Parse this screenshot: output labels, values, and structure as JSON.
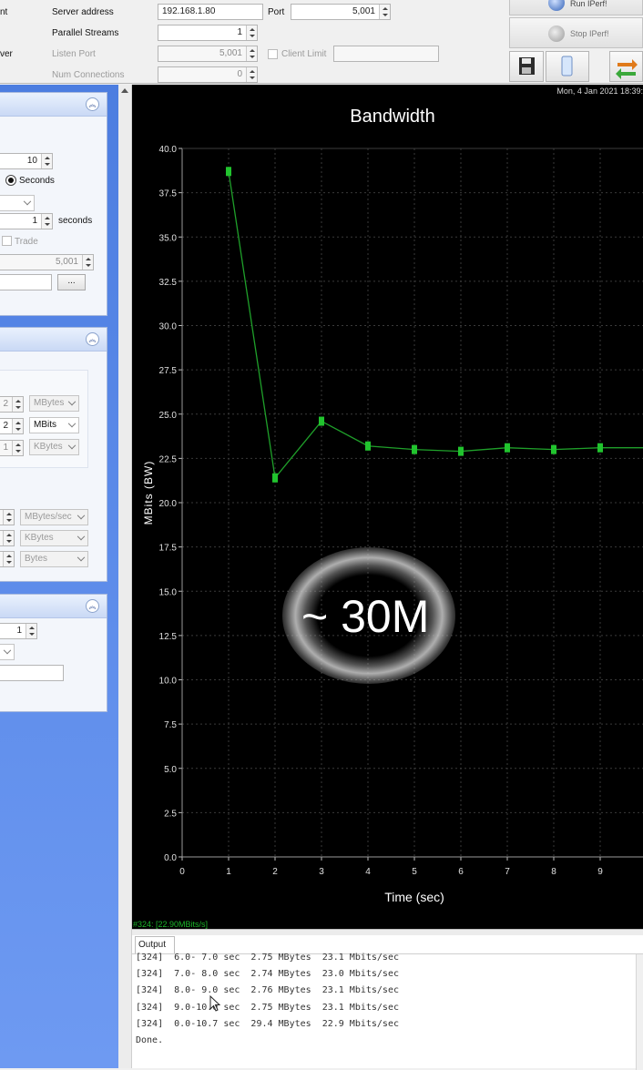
{
  "toolbar": {
    "cut_label_left_1": "nt",
    "cut_label_left_2": "ver",
    "server_address_label": "Server address",
    "server_address_value": "192.168.1.80",
    "port_label": "Port",
    "port_value": "5,001",
    "parallel_streams_label": "Parallel Streams",
    "parallel_streams_value": "1",
    "listen_port_label": "Listen Port",
    "listen_port_value": "5,001",
    "client_limit_label": "Client Limit",
    "client_limit_value": "",
    "num_connections_label": "Num Connections",
    "num_connections_value": "0",
    "run_label": "Run IPerf!",
    "stop_label": "Stop IPerf!"
  },
  "sidebar": {
    "panel1": {
      "value_top": "10",
      "seconds_radio_label": "Seconds",
      "interval_value": "1",
      "interval_unit": "seconds",
      "trade_label": "Trade",
      "port_value": "5,001",
      "browse_label": "..."
    },
    "panel2": {
      "rows": [
        {
          "value": "2",
          "unit": "MBytes",
          "active": false
        },
        {
          "value": "2",
          "unit": "MBits",
          "active": true
        },
        {
          "value": "1",
          "unit": "KBytes",
          "active": false
        }
      ],
      "rows2": [
        {
          "unit": "MBytes/sec"
        },
        {
          "unit": "KBytes"
        },
        {
          "unit": "Bytes"
        }
      ]
    },
    "panel3": {
      "value": "1"
    }
  },
  "chart": {
    "timestamp": "Mon, 4 Jan 2021 18:39:",
    "status_line": "#324: [22.90MBits/s]",
    "overlay_text": "~ 30M",
    "colors": {
      "background": "#000000",
      "line": "#1fa02a",
      "marker": "#21c42e",
      "grid": "#3a3a3a",
      "text": "#ffffff"
    }
  },
  "chart_data": {
    "type": "line",
    "title": "Bandwidth",
    "xlabel": "Time (sec)",
    "ylabel": "MBits (BW)",
    "xlim": [
      0,
      10
    ],
    "ylim": [
      0,
      40
    ],
    "x_ticks": [
      "0",
      "1",
      "2",
      "3",
      "4",
      "5",
      "6",
      "7",
      "8",
      "9",
      "1"
    ],
    "y_ticks": [
      "0.0",
      "2.5",
      "5.0",
      "7.5",
      "10.0",
      "12.5",
      "15.0",
      "17.5",
      "20.0",
      "22.5",
      "25.0",
      "27.5",
      "30.0",
      "32.5",
      "35.0",
      "37.5",
      "40.0"
    ],
    "grid": true,
    "series": [
      {
        "x": [
          1,
          2,
          3,
          4,
          5,
          6,
          7,
          8,
          9,
          10
        ],
        "values": [
          38.7,
          21.4,
          24.6,
          23.2,
          23.0,
          22.9,
          23.1,
          23.0,
          23.1,
          23.1
        ]
      }
    ]
  },
  "output": {
    "tab_label": "Output",
    "lines": [
      "[324]  6.0- 7.0 sec  2.75 MBytes  23.1 Mbits/sec",
      "[324]  7.0- 8.0 sec  2.74 MBytes  23.0 Mbits/sec",
      "[324]  8.0- 9.0 sec  2.76 MBytes  23.1 Mbits/sec",
      "[324]  9.0-10.0 sec  2.75 MBytes  23.1 Mbits/sec",
      "[324]  0.0-10.7 sec  29.4 MBytes  22.9 Mbits/sec",
      "Done."
    ]
  }
}
